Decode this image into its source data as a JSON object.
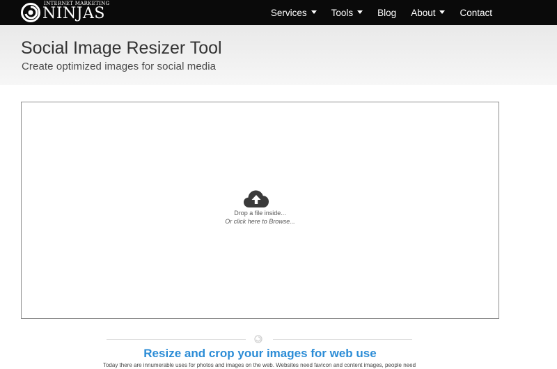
{
  "brand": {
    "top_text": "INTERNET MARKETING",
    "main_text": "NINJAS"
  },
  "nav": {
    "items": [
      {
        "label": "Services",
        "dropdown": true
      },
      {
        "label": "Tools",
        "dropdown": true
      },
      {
        "label": "Blog",
        "dropdown": false
      },
      {
        "label": "About",
        "dropdown": true
      },
      {
        "label": "Contact",
        "dropdown": false
      }
    ]
  },
  "header": {
    "title": "Social Image Resizer Tool",
    "subtitle": "Create optimized images for social media"
  },
  "dropzone": {
    "icon": "cloud-upload-icon",
    "prompt": "Drop a file inside...",
    "browse": "Or click here to Browse..."
  },
  "section": {
    "divider_icon": "swirl-icon",
    "title": "Resize and crop your images for web use",
    "body": "Today there are innumerable uses for photos and images on the web. Websites need favicon and content images, people need"
  },
  "colors": {
    "navbar": "#0a0a0a",
    "accent": "#2b8cd6",
    "header_band": "#efefef"
  }
}
